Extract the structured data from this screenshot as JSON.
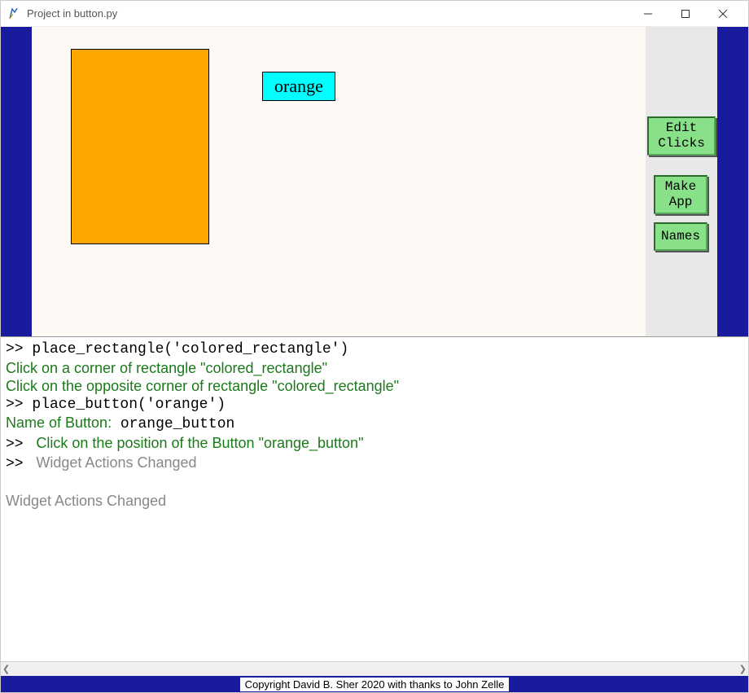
{
  "window": {
    "title": "Project in button.py"
  },
  "canvas": {
    "rectangle_color": "orange",
    "button_label": "orange"
  },
  "sidebar": {
    "edit_clicks": "Edit\nClicks",
    "make_app": "Make\nApp",
    "names": "Names"
  },
  "console": {
    "lines": [
      {
        "style": "mono",
        "text": ">> place_rectangle('colored_rectangle')"
      },
      {
        "style": "green",
        "text": "Click on a corner of rectangle \"colored_rectangle\""
      },
      {
        "style": "green",
        "text": "Click on the opposite corner of rectangle \"colored_rectangle\""
      },
      {
        "style": "mono",
        "text": ">> place_button('orange')"
      },
      {
        "style": "namepair",
        "label": "Name of Button:",
        "value": " orange_button"
      },
      {
        "style": "greenprompt",
        "prefix": ">> ",
        "text": " Click on the position of the Button \"orange_button\""
      },
      {
        "style": "greyprompt",
        "prefix": ">> ",
        "text": " Widget Actions Changed"
      },
      {
        "style": "blank",
        "text": ""
      },
      {
        "style": "grey",
        "text": "Widget Actions Changed"
      }
    ]
  },
  "footer": {
    "copyright": "Copyright David B. Sher 2020 with thanks to John Zelle"
  }
}
